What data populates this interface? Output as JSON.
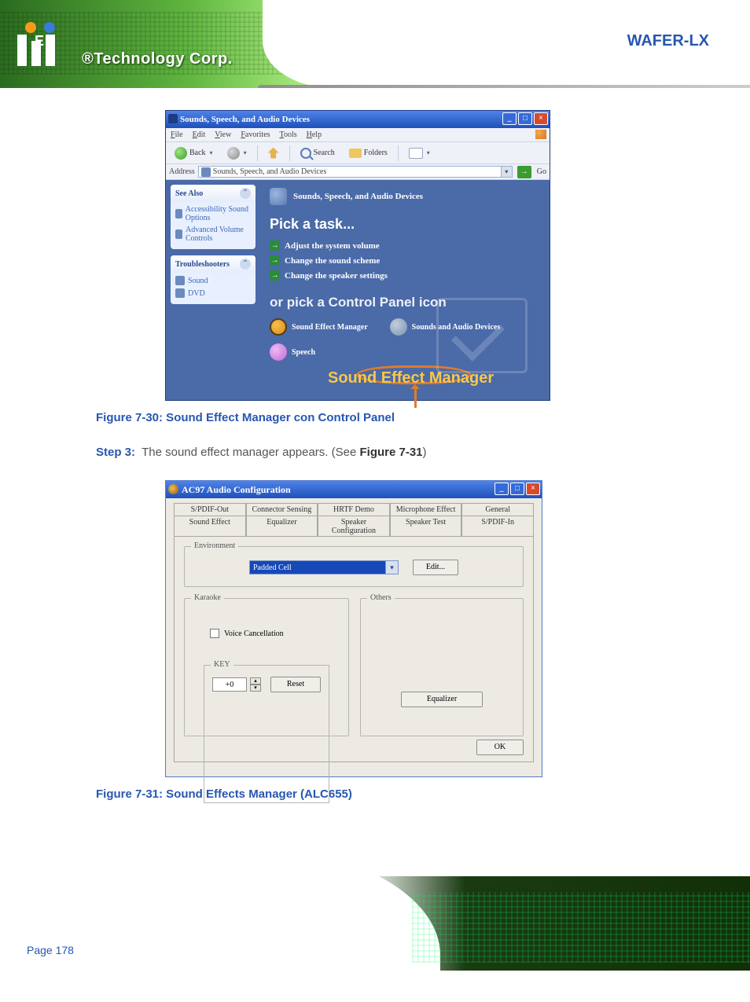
{
  "header": {
    "tagline": "®Technology Corp.",
    "badge": "WAFER-LX"
  },
  "footer": {
    "page": "Page 178"
  },
  "captions": {
    "fig1": "Figure 7-30: Sound Effect Manager con Control Panel",
    "step": {
      "prefix": "Step 3:",
      "body": "The sound effect manager appears. (See",
      "ref": "Figure 7-31",
      "tail": ")"
    },
    "fig2": "Figure 7-31: Sound Effects Manager (ALC655)"
  },
  "win1": {
    "title": "Sounds, Speech, and Audio Devices",
    "min": "_",
    "max": "□",
    "close": "×",
    "menu": [
      "File",
      "Edit",
      "View",
      "Favorites",
      "Tools",
      "Help"
    ],
    "tb": {
      "back": "Back",
      "chev": "▾",
      "search": "Search",
      "folders": "Folders",
      "viewchev": "▾"
    },
    "addr": {
      "label": "Address",
      "value": "Sounds, Speech, and Audio Devices",
      "dd": "▾",
      "go": "→",
      "gotxt": "Go"
    },
    "side": {
      "see": {
        "title": "See Also",
        "collapse": "⌃",
        "items": [
          "Accessibility Sound Options",
          "Advanced Volume Controls"
        ]
      },
      "trouble": {
        "title": "Troubleshooters",
        "collapse": "⌃",
        "items": [
          "Sound",
          "DVD"
        ]
      }
    },
    "main": {
      "category": "Sounds, Speech, and Audio Devices",
      "pick": "Pick a task...",
      "tasks": [
        "Adjust the system volume",
        "Change the sound scheme",
        "Change the speaker settings"
      ],
      "or": "or pick a Control Panel icon",
      "icons": {
        "sem": "Sound Effect Manager",
        "sad": "Sounds and Audio Devices",
        "speech": "Speech"
      },
      "arrow": "→",
      "label": "Sound Effect Manager"
    }
  },
  "win2": {
    "title": "AC97 Audio Configuration",
    "min": "_",
    "max": "□",
    "close": "×",
    "tabs_row1": [
      "S/PDIF-Out",
      "Connector Sensing",
      "HRTF Demo",
      "Microphone Effect",
      "General"
    ],
    "tabs_row2": [
      "Sound Effect",
      "Equalizer",
      "Speaker Configuration",
      "Speaker Test",
      "S/PDIF-In"
    ],
    "env": {
      "legend": "Environment",
      "value": "Padded Cell",
      "dd": "▾",
      "edit": "Edit..."
    },
    "kar": {
      "legend": "Karaoke",
      "voice": "Voice Cancellation",
      "key": {
        "legend": "KEY",
        "value": "+0",
        "up": "▴",
        "dn": "▾",
        "reset": "Reset"
      }
    },
    "oth": {
      "legend": "Others",
      "eq": "Equalizer"
    },
    "ok": "OK"
  }
}
